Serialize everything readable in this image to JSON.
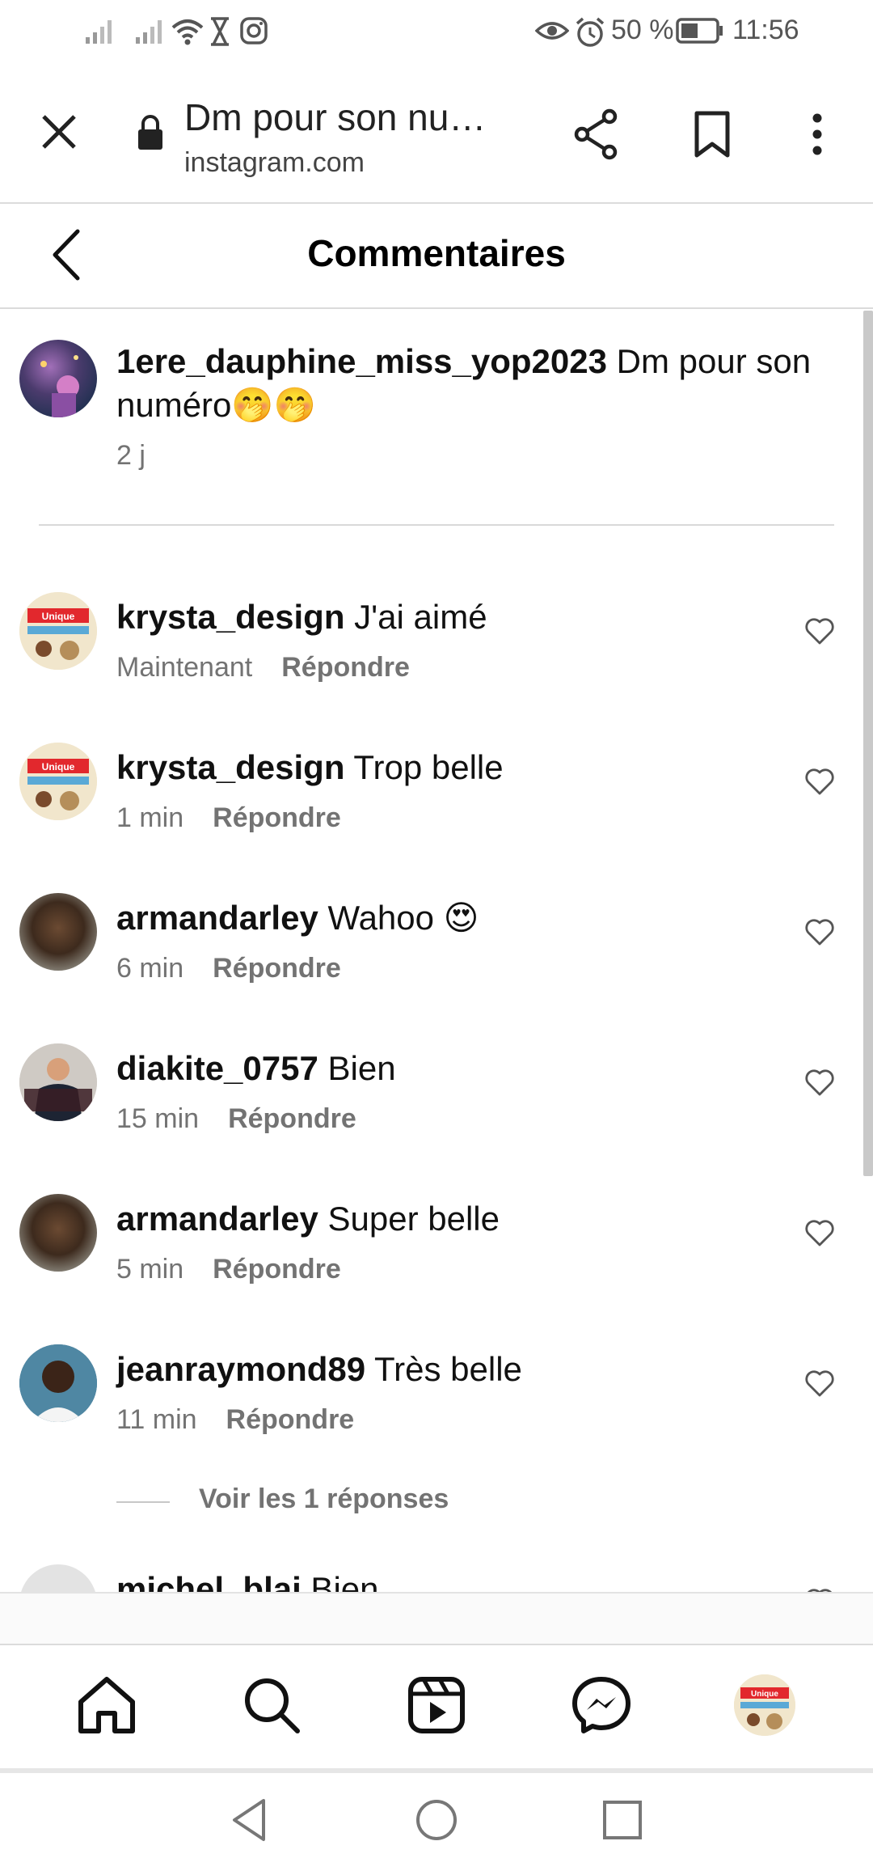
{
  "status_bar": {
    "battery": "50 %",
    "time": "11:56",
    "icons": [
      "signal-icon",
      "signal-icon",
      "wifi-icon",
      "hourglass-icon",
      "instagram-icon",
      "eye-icon",
      "alarm-icon",
      "battery-icon"
    ]
  },
  "browser": {
    "title": "Dm pour son nu…",
    "url": "instagram.com",
    "icons": [
      "close-icon",
      "lock-icon",
      "share-icon",
      "bookmark-icon",
      "more-icon"
    ]
  },
  "header": {
    "title": "Commentaires",
    "back_icon": "chevron-left-icon"
  },
  "caption": {
    "username": "1ere_dauphine_miss_yop2023",
    "text": " Dm pour son numéro🤭🤭",
    "time": "2 j"
  },
  "comments": [
    {
      "username": "krysta_design",
      "text": " J'ai aimé",
      "time": "Maintenant",
      "reply": "Répondre"
    },
    {
      "username": "krysta_design",
      "text": " Trop belle",
      "time": "1 min",
      "reply": "Répondre"
    },
    {
      "username": "armandarley",
      "text": " Wahoo 😍",
      "time": "6 min",
      "reply": "Répondre"
    },
    {
      "username": "diakite_0757",
      "text": " Bien",
      "time": "15 min",
      "reply": "Répondre"
    },
    {
      "username": "armandarley",
      "text": " Super belle",
      "time": "5 min",
      "reply": "Répondre"
    },
    {
      "username": "jeanraymond89",
      "text": " Très belle",
      "time": "11 min",
      "reply": "Répondre"
    },
    {
      "username": "michel_blai",
      "text": " Bien",
      "time": "",
      "reply": ""
    }
  ],
  "view_replies": "Voir les 1 réponses",
  "avatar_badge": "Unique",
  "nav": {
    "items": [
      "home-icon",
      "search-icon",
      "reels-icon",
      "messenger-icon",
      "profile-avatar"
    ]
  },
  "colors": {
    "muted": "#737373",
    "divider": "#dbdbdb",
    "text": "#000000"
  }
}
